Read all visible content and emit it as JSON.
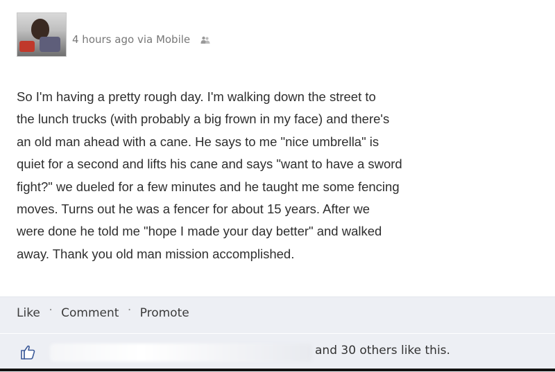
{
  "post": {
    "meta": {
      "timestamp": "4 hours ago",
      "via": "via Mobile",
      "privacy_icon": "friends-icon"
    },
    "text": "So I'm having a pretty rough day. I'm walking down the street to\nthe lunch trucks (with probably a big frown in my face) and there's\nan old man ahead with a cane. He says to me \"nice umbrella\" is\nquiet for a second and lifts his cane and says \"want to have a sword\nfight?\" we dueled for a few minutes and he taught me some fencing\nmoves. Turns out he was a fencer for about 15 years. After we\nwere done he told me \"hope I made your day better\" and walked\naway. Thank you old man mission accomplished.",
    "actions": {
      "like": "Like",
      "comment": "Comment",
      "promote": "Promote",
      "separator": "·"
    },
    "likes": {
      "icon": "thumbs-up-icon",
      "text": "and 30 others like this."
    }
  },
  "colors": {
    "action_bar_bg": "#edeff4",
    "meta_text": "#777777",
    "body_text": "#2e2e2e"
  }
}
